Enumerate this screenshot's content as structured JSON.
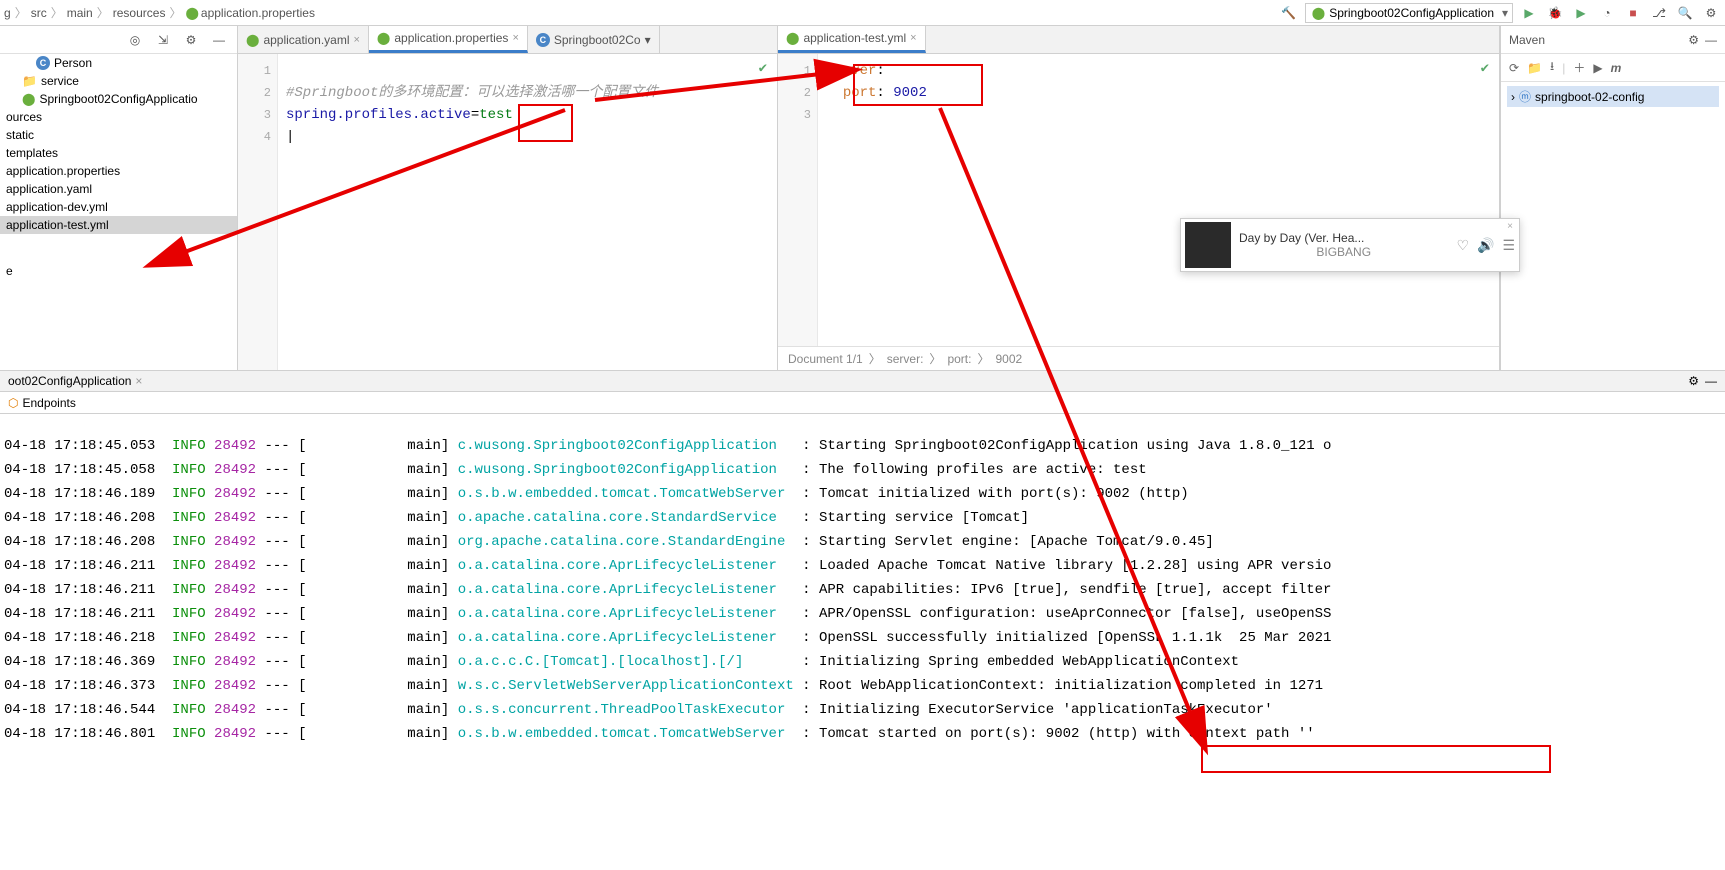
{
  "breadcrumb": [
    "g",
    "src",
    "main",
    "resources",
    "application.properties"
  ],
  "runConfig": "Springboot02ConfigApplication",
  "tree": {
    "person": "Person",
    "service": "service",
    "app": "Springboot02ConfigApplicatio",
    "sources": "ources",
    "static": "static",
    "templates": "templates",
    "appprop": "application.properties",
    "appyaml": "application.yaml",
    "appdev": "application-dev.yml",
    "apptest": "application-test.yml",
    "e": "e"
  },
  "tabsLeft": [
    {
      "label": "application.yaml",
      "active": false
    },
    {
      "label": "application.properties",
      "active": true
    },
    {
      "label": "Springboot02Co",
      "active": false,
      "chevron": true
    }
  ],
  "tabsRight": [
    {
      "label": "application-test.yml",
      "active": true
    }
  ],
  "codeLeft": {
    "comment": "#Springboot的多环境配置：可以选择激活哪一个配置文件",
    "key": "spring.profiles.active",
    "val": "test"
  },
  "codeRight": {
    "k1": "server",
    "k2": "port",
    "v": "9002"
  },
  "rightStatus": {
    "doc": "Document 1/1",
    "p1": "server:",
    "p2": "port:",
    "p3": "9002"
  },
  "maven": {
    "title": "Maven",
    "project": "springboot-02-config"
  },
  "music": {
    "title": "Day by Day (Ver. Hea...",
    "artist": "BIGBANG"
  },
  "runTabLabel": "oot02ConfigApplication",
  "endpoints": "Endpoints",
  "console": [
    {
      "t": "04-18 17:18:45.053",
      "lv": "INFO",
      "pid": "28492",
      "th": "main",
      "lg": "c.wusong.Springboot02ConfigApplication",
      "m": "Starting Springboot02ConfigApplication using Java 1.8.0_121 o"
    },
    {
      "t": "04-18 17:18:45.058",
      "lv": "INFO",
      "pid": "28492",
      "th": "main",
      "lg": "c.wusong.Springboot02ConfigApplication",
      "m": "The following profiles are active: test"
    },
    {
      "t": "04-18 17:18:46.189",
      "lv": "INFO",
      "pid": "28492",
      "th": "main",
      "lg": "o.s.b.w.embedded.tomcat.TomcatWebServer",
      "m": "Tomcat initialized with port(s): 9002 (http)"
    },
    {
      "t": "04-18 17:18:46.208",
      "lv": "INFO",
      "pid": "28492",
      "th": "main",
      "lg": "o.apache.catalina.core.StandardService",
      "m": "Starting service [Tomcat]"
    },
    {
      "t": "04-18 17:18:46.208",
      "lv": "INFO",
      "pid": "28492",
      "th": "main",
      "lg": "org.apache.catalina.core.StandardEngine",
      "m": "Starting Servlet engine: [Apache Tomcat/9.0.45]"
    },
    {
      "t": "04-18 17:18:46.211",
      "lv": "INFO",
      "pid": "28492",
      "th": "main",
      "lg": "o.a.catalina.core.AprLifecycleListener",
      "m": "Loaded Apache Tomcat Native library [1.2.28] using APR versio"
    },
    {
      "t": "04-18 17:18:46.211",
      "lv": "INFO",
      "pid": "28492",
      "th": "main",
      "lg": "o.a.catalina.core.AprLifecycleListener",
      "m": "APR capabilities: IPv6 [true], sendfile [true], accept filter"
    },
    {
      "t": "04-18 17:18:46.211",
      "lv": "INFO",
      "pid": "28492",
      "th": "main",
      "lg": "o.a.catalina.core.AprLifecycleListener",
      "m": "APR/OpenSSL configuration: useAprConnector [false], useOpenSS"
    },
    {
      "t": "04-18 17:18:46.218",
      "lv": "INFO",
      "pid": "28492",
      "th": "main",
      "lg": "o.a.catalina.core.AprLifecycleListener",
      "m": "OpenSSL successfully initialized [OpenSSL 1.1.1k  25 Mar 2021"
    },
    {
      "t": "04-18 17:18:46.369",
      "lv": "INFO",
      "pid": "28492",
      "th": "main",
      "lg": "o.a.c.c.C.[Tomcat].[localhost].[/]",
      "m": "Initializing Spring embedded WebApplicationContext"
    },
    {
      "t": "04-18 17:18:46.373",
      "lv": "INFO",
      "pid": "28492",
      "th": "main",
      "lg": "w.s.c.ServletWebServerApplicationContext",
      "m": "Root WebApplicationContext: initialization completed in 1271"
    },
    {
      "t": "04-18 17:18:46.544",
      "lv": "INFO",
      "pid": "28492",
      "th": "main",
      "lg": "o.s.s.concurrent.ThreadPoolTaskExecutor",
      "m": "Initializing ExecutorService 'applicationTaskExecutor'"
    },
    {
      "t": "04-18 17:18:46.801",
      "lv": "INFO",
      "pid": "28492",
      "th": "main",
      "lg": "o.s.b.w.embedded.tomcat.TomcatWebServer",
      "m": "Tomcat started on port(s): 9002 (http) with context path ''"
    }
  ]
}
